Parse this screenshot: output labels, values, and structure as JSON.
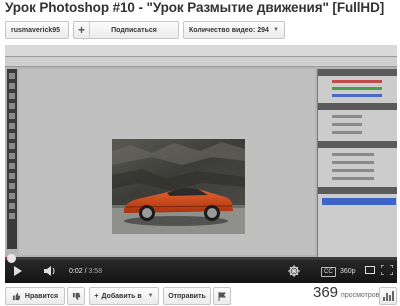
{
  "video": {
    "title": "Урок Photoshop #10 - \"Урок Размытие движения\" [FullHD]"
  },
  "channel": {
    "name": "rusmaverick95",
    "subscribe_label": "Подписаться",
    "video_count_label": "Количество видео: 294"
  },
  "player": {
    "current_time": "0:02",
    "duration": "3:58",
    "progress": 0.012,
    "cc_label": "CC",
    "quality_label": "360p"
  },
  "actions": {
    "like_label": "Нравится",
    "add_label": "Добавить в",
    "share_label": "Отправить",
    "views_count": "369",
    "views_label": "просмотров"
  },
  "icons": {
    "plus": "plus-icon",
    "caret": "caret-down-icon",
    "like": "thumbs-up-icon",
    "dislike": "thumbs-down-icon",
    "play": "play-icon",
    "volume": "volume-icon",
    "annotations": "annotations-icon",
    "fullscreen": "fullscreen-icon",
    "stats": "stats-icon"
  },
  "colors": {
    "progress": "#cc181e",
    "car": "#d2461b",
    "selected_layer": "#3b64c4"
  }
}
